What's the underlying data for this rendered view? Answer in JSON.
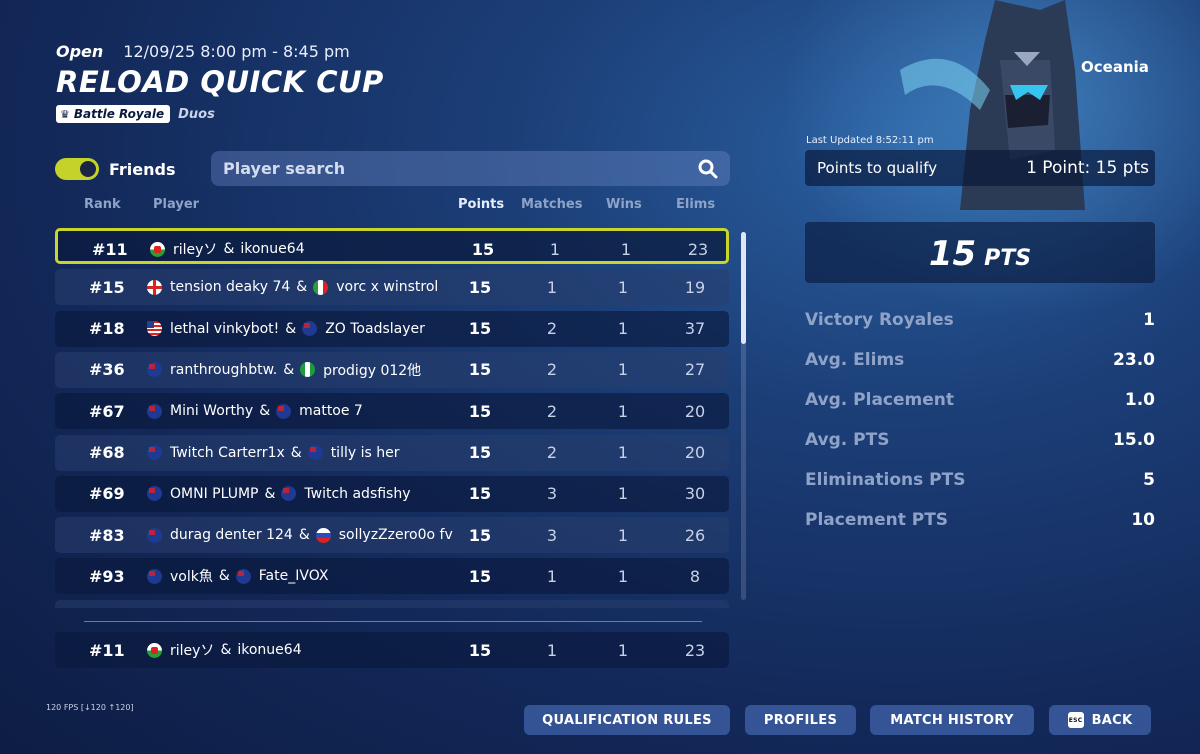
{
  "event": {
    "status": "Open",
    "datetime": "12/09/25 8:00 pm - 8:45 pm",
    "title": "RELOAD QUICK CUP",
    "mode": "Battle Royale",
    "team_size": "Duos"
  },
  "region": "Oceania",
  "filters": {
    "friends_label": "Friends",
    "friends_on": true,
    "search_placeholder": "Player search"
  },
  "columns": {
    "rank": "Rank",
    "player": "Player",
    "points": "Points",
    "matches": "Matches",
    "wins": "Wins",
    "elims": "Elims"
  },
  "rows": [
    {
      "rank": "#11",
      "p1_flag": "wales",
      "p1": "rileyソ",
      "p2_flag": "",
      "p2": "ikonue64",
      "points": "15",
      "matches": "1",
      "wins": "1",
      "elims": "23",
      "selected": true
    },
    {
      "rank": "#15",
      "p1_flag": "england",
      "p1": "tension deaky 74",
      "p2_flag": "italy",
      "p2": "vorc x winstrol",
      "points": "15",
      "matches": "1",
      "wins": "1",
      "elims": "19"
    },
    {
      "rank": "#18",
      "p1_flag": "usa",
      "p1": "lethal vinkybot!",
      "p2_flag": "australia",
      "p2": "ZO Toadslayer",
      "points": "15",
      "matches": "2",
      "wins": "1",
      "elims": "37"
    },
    {
      "rank": "#36",
      "p1_flag": "australia",
      "p1": "ranthroughbtw.",
      "p2_flag": "nigeria",
      "p2": "prodigy 012他",
      "points": "15",
      "matches": "2",
      "wins": "1",
      "elims": "27"
    },
    {
      "rank": "#67",
      "p1_flag": "australia",
      "p1": "Mini Worthy",
      "p2_flag": "australia",
      "p2": "mattoe 7",
      "points": "15",
      "matches": "2",
      "wins": "1",
      "elims": "20"
    },
    {
      "rank": "#68",
      "p1_flag": "australia",
      "p1": "Twitch Carterr1x",
      "p2_flag": "australia",
      "p2": "tilly is her",
      "points": "15",
      "matches": "2",
      "wins": "1",
      "elims": "20"
    },
    {
      "rank": "#69",
      "p1_flag": "australia",
      "p1": "OMNI PLUMP",
      "p2_flag": "australia",
      "p2": "Twitch adsfishy",
      "points": "15",
      "matches": "3",
      "wins": "1",
      "elims": "30"
    },
    {
      "rank": "#83",
      "p1_flag": "australia",
      "p1": "durag denter 124",
      "p2_flag": "russia",
      "p2": "sollyzZzero0o fv",
      "points": "15",
      "matches": "3",
      "wins": "1",
      "elims": "26"
    },
    {
      "rank": "#93",
      "p1_flag": "australia",
      "p1": "volk魚",
      "p2_flag": "australia",
      "p2": "Fate_IVOX",
      "points": "15",
      "matches": "1",
      "wins": "1",
      "elims": "8"
    }
  ],
  "own_row": {
    "rank": "#11",
    "p1_flag": "wales",
    "p1": "rileyソ",
    "p2_flag": "",
    "p2": "ikonue64",
    "points": "15",
    "matches": "1",
    "wins": "1",
    "elims": "23"
  },
  "separator": "&",
  "stats": {
    "last_updated": "Last Updated 8:52:11 pm",
    "qualify_label": "Points to qualify",
    "qualify_value": "1 Point: 15 pts",
    "total_points": "15",
    "total_unit": "PTS",
    "items": [
      {
        "label": "Victory Royales",
        "value": "1"
      },
      {
        "label": "Avg. Elims",
        "value": "23.0"
      },
      {
        "label": "Avg. Placement",
        "value": "1.0"
      },
      {
        "label": "Avg. PTS",
        "value": "15.0"
      },
      {
        "label": "Eliminations PTS",
        "value": "5"
      },
      {
        "label": "Placement PTS",
        "value": "10"
      }
    ]
  },
  "footer": {
    "fps": "120 FPS [↓120 ↑120]",
    "buttons": {
      "qualification_rules": "QUALIFICATION RULES",
      "profiles": "PROFILES",
      "match_history": "MATCH HISTORY",
      "back": "BACK",
      "back_key": "ESC"
    }
  },
  "colors": {
    "accent": "#c8d52a",
    "background": "#13295a",
    "muted_label": "#8fa3c8"
  }
}
